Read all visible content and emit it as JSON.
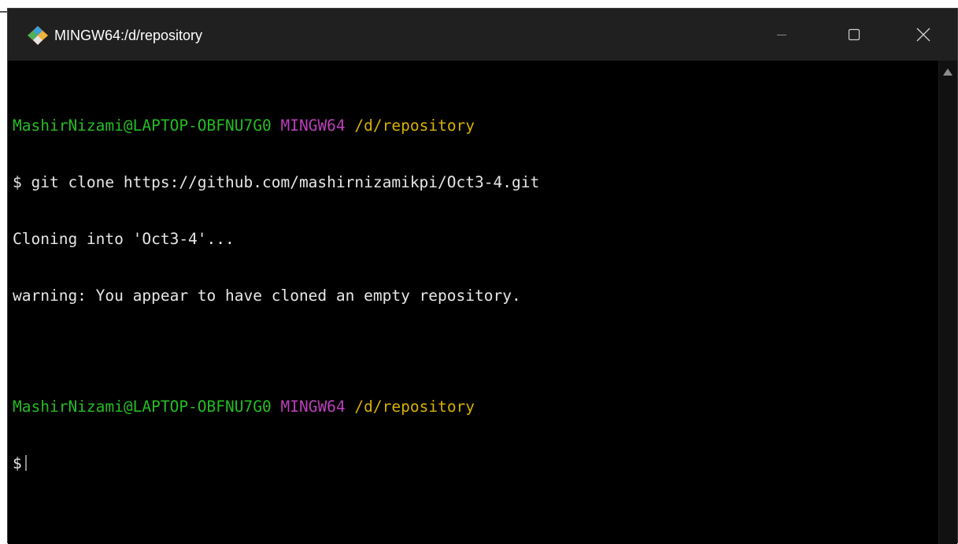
{
  "window": {
    "title": "MINGW64:/d/repository",
    "controls": {
      "minimize_icon": "minimize-icon",
      "maximize_icon": "maximize-icon",
      "close_icon": "close-icon"
    }
  },
  "colors": {
    "user_host": "#25bc24",
    "msystem": "#bc3fbc",
    "path": "#d7b100",
    "output": "#e6e6e6",
    "background": "#000000",
    "titlebar": "#202020"
  },
  "terminal": {
    "prompt1": {
      "user_host": "MashirNizami@LAPTOP-OBFNU7G0",
      "msystem": "MINGW64",
      "path": "/d/repository"
    },
    "command1": "$ git clone https://github.com/mashirnizamikpi/Oct3-4.git",
    "output1": "Cloning into 'Oct3-4'...",
    "output2": "warning: You appear to have cloned an empty repository.",
    "prompt2": {
      "user_host": "MashirNizami@LAPTOP-OBFNU7G0",
      "msystem": "MINGW64",
      "path": "/d/repository"
    },
    "command2": "$"
  }
}
